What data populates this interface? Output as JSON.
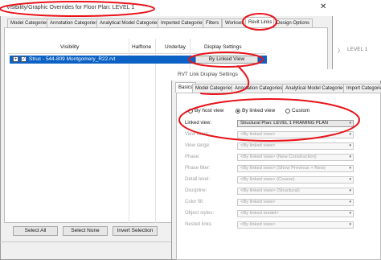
{
  "vg_dialog": {
    "title": "Visibility/Graphic Overrides for Floor Plan: LEVEL 1",
    "close_label": "✕",
    "tabs": [
      {
        "label": "Model Categories"
      },
      {
        "label": "Annotation Categories"
      },
      {
        "label": "Analytical Model Categories"
      },
      {
        "label": "Imported Categories"
      },
      {
        "label": "Filters"
      },
      {
        "label": "Workset"
      },
      {
        "label": "Revit Links"
      },
      {
        "label": "Design Options"
      }
    ],
    "active_tab": "Revit Links",
    "columns": {
      "visibility": "Visibility",
      "halftone": "Halftone",
      "underlay": "Underlay",
      "display_settings": "Display Settings"
    },
    "row": {
      "expander": "+",
      "check": "✓",
      "name": "Struc - 544-809 Montgomery_R22.rvt",
      "display_setting": "By Linked View"
    },
    "buttons": {
      "select_all": "Select All",
      "select_none": "Select None",
      "invert_selection": "Invert Selection"
    }
  },
  "background_view": {
    "chevron": "〉",
    "level_label": "LEVEL 1"
  },
  "rvt_dialog": {
    "title": "RVT Link Display Settings",
    "tabs": [
      {
        "label": "Basics"
      },
      {
        "label": "Model Categories"
      },
      {
        "label": "Annotation Categories"
      },
      {
        "label": "Analytical Model Categories"
      },
      {
        "label": "Import Categories"
      }
    ],
    "active_tab": "Basics",
    "radios": [
      {
        "label": "By host view",
        "selected": false
      },
      {
        "label": "By linked view",
        "selected": true
      },
      {
        "label": "Custom",
        "selected": false
      }
    ],
    "fields": [
      {
        "label": "Linked view:",
        "value": "Structural Plan: LEVEL 1 FRAMING PLAN",
        "enabled": true
      },
      {
        "label": "View filters:",
        "value": "<By linked view>",
        "enabled": false
      },
      {
        "label": "View range:",
        "value": "<By linked view>",
        "enabled": false
      },
      {
        "label": "Phase:",
        "value": "<By linked view> (New Construction)",
        "enabled": false
      },
      {
        "label": "Phase filter:",
        "value": "<By linked view> (Show Previous + New)",
        "enabled": false
      },
      {
        "label": "Detail level:",
        "value": "<By linked view> (Coarse)",
        "enabled": false
      },
      {
        "label": "Discipline:",
        "value": "<By linked view> (Structural)",
        "enabled": false
      },
      {
        "label": "Color fill:",
        "value": "<By linked view>",
        "enabled": false
      },
      {
        "label": "Object styles:",
        "value": "<By linked model>",
        "enabled": false
      },
      {
        "label": "Nested links:",
        "value": "<By linked view>",
        "enabled": false
      }
    ],
    "dropdown_glyph": "▾"
  },
  "colors": {
    "selection": "#0b61c4",
    "annotation": "#e8141b"
  }
}
